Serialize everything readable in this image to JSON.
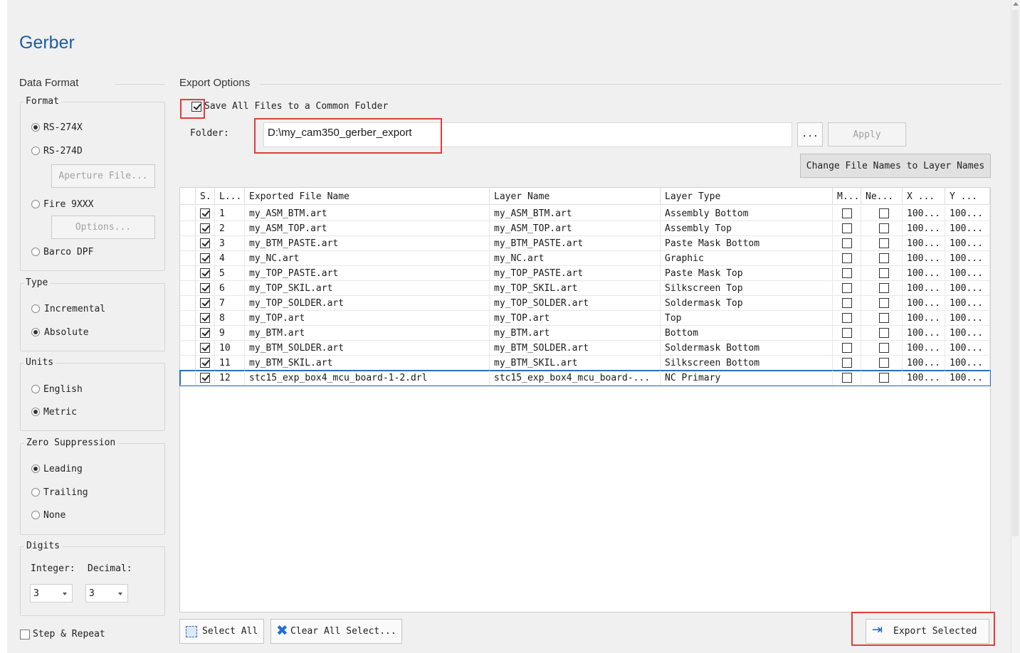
{
  "title": "Gerber",
  "data_format": {
    "label": "Data Format",
    "format": {
      "title": "Format",
      "options": [
        "RS-274X",
        "RS-274D",
        "Fire 9XXX",
        "Barco DPF"
      ],
      "selected": "RS-274X",
      "aperture_button": "Aperture File...",
      "options_button": "Options..."
    },
    "type": {
      "title": "Type",
      "options": [
        "Incremental",
        "Absolute"
      ],
      "selected": "Absolute"
    },
    "units": {
      "title": "Units",
      "options": [
        "English",
        "Metric"
      ],
      "selected": "Metric"
    },
    "zero_suppression": {
      "title": "Zero Suppression",
      "options": [
        "Leading",
        "Trailing",
        "None"
      ],
      "selected": "Leading"
    },
    "digits": {
      "title": "Digits",
      "integer_label": "Integer:",
      "decimal_label": "Decimal:",
      "integer_value": "3",
      "decimal_value": "3"
    },
    "step_repeat": "Step & Repeat"
  },
  "export_options": {
    "label": "Export Options",
    "save_common": "Save All Files to a Common Folder",
    "folder_label": "Folder:",
    "folder_value": "D:\\my_cam350_gerber_export",
    "browse": "...",
    "apply": "Apply",
    "change_names": "Change File Names to Layer Names"
  },
  "grid": {
    "columns": [
      "S.",
      "L...",
      "Exported File Name",
      "Layer Name",
      "Layer Type",
      "M...",
      "Ne...",
      "X ...",
      "Y ..."
    ],
    "rows": [
      {
        "num": "1",
        "file": "my_ASM_BTM.art",
        "layer": "my_ASM_BTM.art",
        "type": "Assembly Bottom",
        "x": "100...",
        "y": "100..."
      },
      {
        "num": "2",
        "file": "my_ASM_TOP.art",
        "layer": "my_ASM_TOP.art",
        "type": "Assembly Top",
        "x": "100...",
        "y": "100..."
      },
      {
        "num": "3",
        "file": "my_BTM_PASTE.art",
        "layer": "my_BTM_PASTE.art",
        "type": "Paste Mask Bottom",
        "x": "100...",
        "y": "100..."
      },
      {
        "num": "4",
        "file": "my_NC.art",
        "layer": "my_NC.art",
        "type": "Graphic",
        "x": "100...",
        "y": "100..."
      },
      {
        "num": "5",
        "file": "my_TOP_PASTE.art",
        "layer": "my_TOP_PASTE.art",
        "type": "Paste Mask Top",
        "x": "100...",
        "y": "100..."
      },
      {
        "num": "6",
        "file": "my_TOP_SKIL.art",
        "layer": "my_TOP_SKIL.art",
        "type": "Silkscreen Top",
        "x": "100...",
        "y": "100..."
      },
      {
        "num": "7",
        "file": "my_TOP_SOLDER.art",
        "layer": "my_TOP_SOLDER.art",
        "type": "Soldermask Top",
        "x": "100...",
        "y": "100..."
      },
      {
        "num": "8",
        "file": "my_TOP.art",
        "layer": "my_TOP.art",
        "type": "Top",
        "x": "100...",
        "y": "100..."
      },
      {
        "num": "9",
        "file": "my_BTM.art",
        "layer": "my_BTM.art",
        "type": "Bottom",
        "x": "100...",
        "y": "100..."
      },
      {
        "num": "10",
        "file": "my_BTM_SOLDER.art",
        "layer": "my_BTM_SOLDER.art",
        "type": "Soldermask Bottom",
        "x": "100...",
        "y": "100..."
      },
      {
        "num": "11",
        "file": "my_BTM_SKIL.art",
        "layer": "my_BTM_SKIL.art",
        "type": "Silkscreen Bottom",
        "x": "100...",
        "y": "100..."
      },
      {
        "num": "12",
        "file": "stc15_exp_box4_mcu_board-1-2.drl",
        "layer": "stc15_exp_box4_mcu_board-...",
        "type": "NC Primary",
        "x": "100...",
        "y": "100..."
      }
    ]
  },
  "footer": {
    "select_all": "Select All",
    "clear_all": "Clear All Select...",
    "export_selected": "Export Selected"
  },
  "colors": {
    "title": "#1f5c9e",
    "highlight": "#e23c3c",
    "selection": "#2a6ebb"
  },
  "icons": [
    "select-all-icon",
    "clear-all-icon",
    "export-arrow-icon",
    "checkmark-icon",
    "chevron-down-icon"
  ]
}
